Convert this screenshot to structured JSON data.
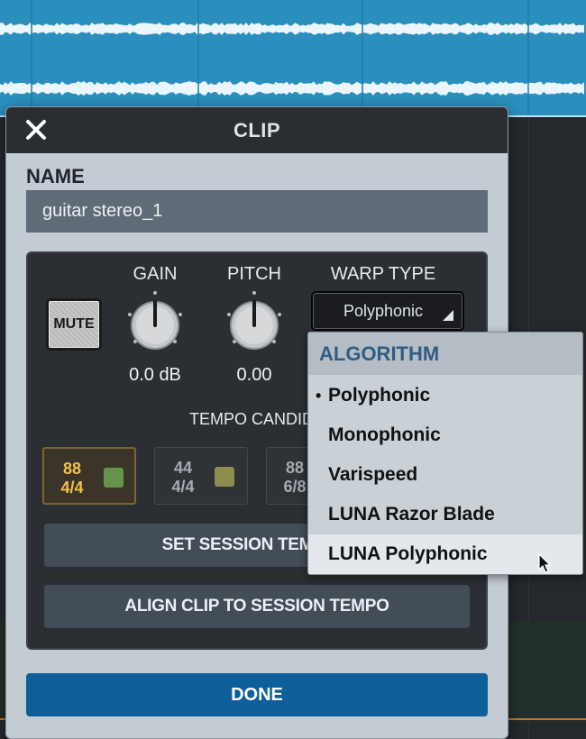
{
  "dialog": {
    "title": "CLIP",
    "close_icon": "close-icon",
    "name_label": "NAME",
    "name_value": "guitar stereo_1"
  },
  "controls": {
    "mute_label": "MUTE",
    "gain": {
      "label": "GAIN",
      "value": "0.0 dB"
    },
    "pitch": {
      "label": "PITCH",
      "value": "0.00"
    },
    "warp": {
      "label": "WARP TYPE",
      "selected": "Polyphonic"
    },
    "tempo_label": "TEMPO CANDIDA",
    "tempo_candidates": [
      {
        "bpm": "88",
        "meter": "4/4"
      },
      {
        "bpm": "44",
        "meter": "4/4"
      },
      {
        "bpm": "88",
        "meter": "6/8"
      }
    ],
    "set_session_tempo_label": "SET SESSION TEMPO T",
    "align_clip_label": "ALIGN CLIP TO SESSION TEMPO"
  },
  "done_label": "DONE",
  "algorithm_menu": {
    "header": "ALGORITHM",
    "selected_marker": "•",
    "items": [
      "Polyphonic",
      "Monophonic",
      "Varispeed",
      "LUNA Razor Blade",
      "LUNA Polyphonic"
    ],
    "selected_index": 0,
    "hovered_index": 4
  },
  "colors": {
    "track_waveform_bg": "#2b8fbd",
    "done_button": "#0e5f99",
    "algorithm_header_text": "#2f5d84",
    "active_tempo_text": "#f0c14b"
  }
}
